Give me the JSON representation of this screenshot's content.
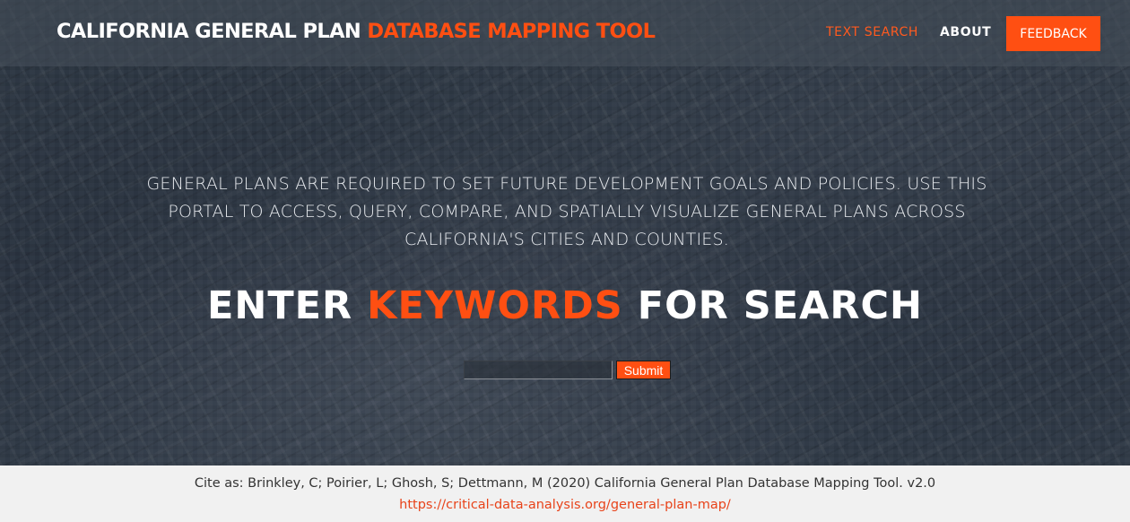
{
  "header": {
    "brand_white": "CALIFORNIA GENERAL PLAN",
    "brand_accent": "DATABASE MAPPING TOOL",
    "nav_text_search": "TEXT SEARCH",
    "nav_about": "ABOUT",
    "feedback_label": "FEEDBACK"
  },
  "hero": {
    "intro": "GENERAL PLANS ARE REQUIRED TO SET FUTURE DEVELOPMENT GOALS AND POLICIES. USE THIS PORTAL TO ACCESS, QUERY, COMPARE, AND SPATIALLY VISUALIZE GENERAL PLANS ACROSS CALIFORNIA'S CITIES AND COUNTIES.",
    "headline_pre": "ENTER",
    "headline_keyword": "KEYWORDS",
    "headline_post": "FOR SEARCH",
    "search_value": "",
    "submit_label": "Submit"
  },
  "footer": {
    "citation": "Cite as: Brinkley, C; Poirier, L; Ghosh, S; Dettmann, M (2020) California General Plan Database Mapping Tool. v2.0",
    "link": "https://critical-data-analysis.org/general-plan-map/"
  },
  "colors": {
    "accent": "#ff4f12",
    "hero_bg": "#2a3340",
    "footer_bg": "#f1f1f1"
  }
}
